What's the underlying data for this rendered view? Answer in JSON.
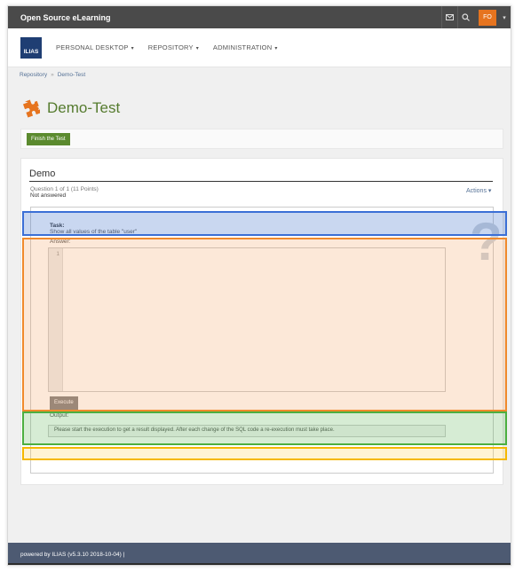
{
  "topbar": {
    "brand": "Open Source eLearning",
    "mail_icon": "mail-icon",
    "search_icon": "search-icon",
    "user_initials": "FO",
    "user_caret": "▾"
  },
  "logo": {
    "text": "ILIAS"
  },
  "nav": {
    "items": [
      {
        "label": "PERSONAL DESKTOP"
      },
      {
        "label": "REPOSITORY"
      },
      {
        "label": "ADMINISTRATION"
      }
    ],
    "caret": "▾"
  },
  "breadcrumb": {
    "items": [
      "Repository",
      "Demo-Test"
    ],
    "separator": "»"
  },
  "page": {
    "title": "Demo-Test",
    "icon": "puzzle-icon",
    "finish_button": "Finish the Test"
  },
  "question": {
    "heading": "Demo",
    "meta": "Question 1 of 1 (11 Points)",
    "status": "Not answered",
    "actions_label": "Actions",
    "help_icon": "question-mark-icon",
    "task_title": "Task:",
    "task_text": "Show all values of the table \"user\"",
    "answer_label": "Answer:",
    "line_number": "1",
    "execute_button": "Execute",
    "output_label": "Output:",
    "output_text": "Please start the execution to get a result displayed. After each change of the SQL code a re-execution must take place."
  },
  "footer": {
    "text": "powered by ILIAS (v5.3.10 2018-10-04) |"
  },
  "colors": {
    "highlight_blue": "#3b6fd6",
    "highlight_orange": "#f08a2c",
    "highlight_green": "#4caf40",
    "highlight_yellow": "#f5b800",
    "title_green": "#557b2e",
    "user_orange": "#e6741f"
  }
}
